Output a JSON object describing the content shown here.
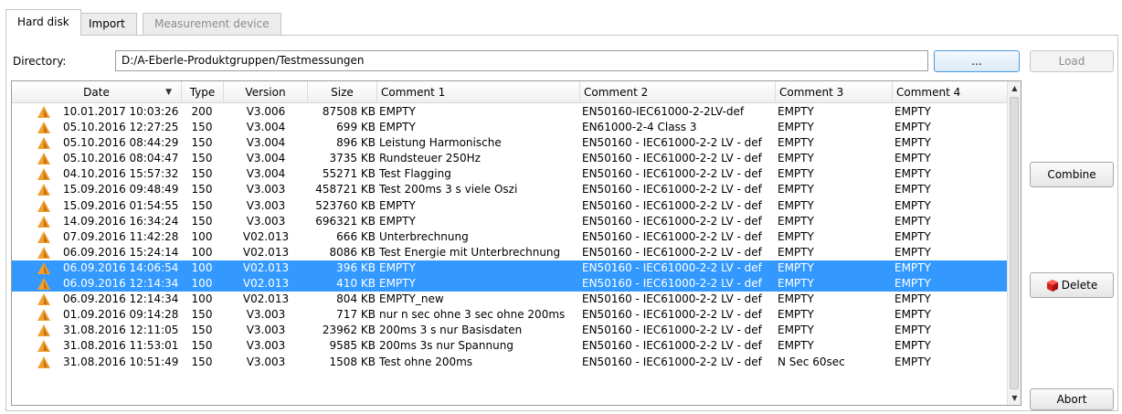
{
  "tabs": [
    {
      "label": "Hard disk",
      "active": true
    },
    {
      "label": "Import",
      "active": false
    },
    {
      "label": "Measurement device",
      "disabled": true
    }
  ],
  "directory": {
    "label": "Directory:",
    "value": "D:/A-Eberle-Produktgruppen/Testmessungen",
    "browse_label": "...",
    "load_label": "Load"
  },
  "buttons": {
    "combine": "Combine",
    "delete": "Delete",
    "abort": "Abort"
  },
  "table": {
    "columns": [
      "Date",
      "Type",
      "Version",
      "Size",
      "Comment 1",
      "Comment 2",
      "Comment 3",
      "Comment 4"
    ],
    "sort_indicator": "▼",
    "rows": [
      {
        "date": "10.01.2017 10:03:26",
        "type": "200",
        "version": "V3.006",
        "size": "87508 KB",
        "c1": "EMPTY",
        "c2": "EN50160-IEC61000-2-2LV-def",
        "c3": "EMPTY",
        "c4": "EMPTY",
        "selected": false
      },
      {
        "date": "05.10.2016 12:27:25",
        "type": "150",
        "version": "V3.004",
        "size": "699 KB",
        "c1": "EMPTY",
        "c2": "EN61000-2-4 Class 3",
        "c3": "EMPTY",
        "c4": "EMPTY",
        "selected": false
      },
      {
        "date": "05.10.2016 08:44:29",
        "type": "150",
        "version": "V3.004",
        "size": "896 KB",
        "c1": "Leistung Harmonische",
        "c2": "EN50160 - IEC61000-2-2 LV - def",
        "c3": "EMPTY",
        "c4": "EMPTY",
        "selected": false
      },
      {
        "date": "05.10.2016 08:04:47",
        "type": "150",
        "version": "V3.004",
        "size": "3735 KB",
        "c1": "Rundsteuer 250Hz",
        "c2": "EN50160 - IEC61000-2-2 LV - def",
        "c3": "EMPTY",
        "c4": "EMPTY",
        "selected": false
      },
      {
        "date": "04.10.2016 15:57:32",
        "type": "150",
        "version": "V3.004",
        "size": "55271 KB",
        "c1": "Test Flagging",
        "c2": "EN50160 - IEC61000-2-2 LV - def",
        "c3": "EMPTY",
        "c4": "EMPTY",
        "selected": false
      },
      {
        "date": "15.09.2016 09:48:49",
        "type": "150",
        "version": "V3.003",
        "size": "458721 KB",
        "c1": "Test 200ms 3 s viele Oszi",
        "c2": "EN50160 - IEC61000-2-2 LV - def",
        "c3": "EMPTY",
        "c4": "EMPTY",
        "selected": false
      },
      {
        "date": "15.09.2016 01:54:55",
        "type": "150",
        "version": "V3.003",
        "size": "523760 KB",
        "c1": "EMPTY",
        "c2": "EN50160 - IEC61000-2-2 LV - def",
        "c3": "EMPTY",
        "c4": "EMPTY",
        "selected": false
      },
      {
        "date": "14.09.2016 16:34:24",
        "type": "150",
        "version": "V3.003",
        "size": "696321 KB",
        "c1": "EMPTY",
        "c2": "EN50160 - IEC61000-2-2 LV - def",
        "c3": "EMPTY",
        "c4": "EMPTY",
        "selected": false
      },
      {
        "date": "07.09.2016 11:42:28",
        "type": "100",
        "version": "V02.013",
        "size": "666 KB",
        "c1": "Unterbrechnung",
        "c2": "EN50160 - IEC61000-2-2 LV - def",
        "c3": "EMPTY",
        "c4": "EMPTY",
        "selected": false
      },
      {
        "date": "06.09.2016 15:24:14",
        "type": "100",
        "version": "V02.013",
        "size": "8086 KB",
        "c1": "Test Energie mit Unterbrechnung",
        "c2": "EN50160 - IEC61000-2-2 LV - def",
        "c3": "EMPTY",
        "c4": "EMPTY",
        "selected": false
      },
      {
        "date": "06.09.2016 14:06:54",
        "type": "100",
        "version": "V02.013",
        "size": "396 KB",
        "c1": "EMPTY",
        "c2": "EN50160 - IEC61000-2-2 LV - def",
        "c3": "EMPTY",
        "c4": "EMPTY",
        "selected": true
      },
      {
        "date": "06.09.2016 12:14:34",
        "type": "100",
        "version": "V02.013",
        "size": "410 KB",
        "c1": "EMPTY",
        "c2": "EN50160 - IEC61000-2-2 LV - def",
        "c3": "EMPTY",
        "c4": "EMPTY",
        "selected": true
      },
      {
        "date": "06.09.2016 12:14:34",
        "type": "100",
        "version": "V02.013",
        "size": "804 KB",
        "c1": "EMPTY_new",
        "c2": "EN50160 - IEC61000-2-2 LV - def",
        "c3": "EMPTY",
        "c4": "EMPTY",
        "selected": false
      },
      {
        "date": "01.09.2016 09:14:28",
        "type": "150",
        "version": "V3.003",
        "size": "717 KB",
        "c1": "nur n sec ohne 3 sec ohne 200ms",
        "c2": "EN50160 - IEC61000-2-2 LV - def",
        "c3": "EMPTY",
        "c4": "EMPTY",
        "selected": false
      },
      {
        "date": "31.08.2016 12:11:05",
        "type": "150",
        "version": "V3.003",
        "size": "23962 KB",
        "c1": "200ms 3 s nur Basisdaten",
        "c2": "EN50160 - IEC61000-2-2 LV - def",
        "c3": "EMPTY",
        "c4": "EMPTY",
        "selected": false
      },
      {
        "date": "31.08.2016 11:53:01",
        "type": "150",
        "version": "V3.003",
        "size": "9585 KB",
        "c1": "200ms 3s nur Spannung",
        "c2": "EN50160 - IEC61000-2-2 LV - def",
        "c3": "EMPTY",
        "c4": "EMPTY",
        "selected": false
      },
      {
        "date": "31.08.2016 10:51:49",
        "type": "150",
        "version": "V3.003",
        "size": "1508 KB",
        "c1": "Test ohne 200ms",
        "c2": "EN50160 - IEC61000-2-2 LV - def",
        "c3": "N Sec 60sec",
        "c4": "EMPTY",
        "selected": false
      }
    ]
  },
  "icons": {
    "row_icon": "warning-triangle-icon",
    "delete_icon": "red-box-delete-icon"
  },
  "colors": {
    "selection": "#3399ff",
    "warning_icon": "#f0a030"
  }
}
